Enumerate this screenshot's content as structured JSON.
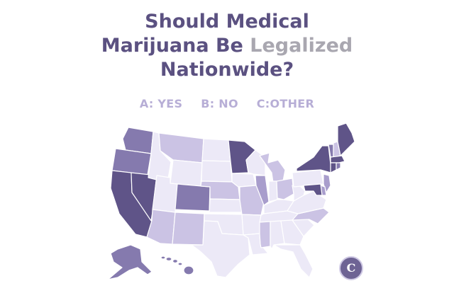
{
  "title": {
    "line1": "Should Medical",
    "line2a": "Marijuana Be ",
    "line2b": "Legalized",
    "line3": "Nationwide?"
  },
  "legend": {
    "a": "A: YES",
    "b": "B: NO",
    "c": "C:OTHER"
  },
  "logo": {
    "glyph": "C"
  },
  "colors": {
    "title": "#5b5181",
    "title_muted": "#a9a7b0",
    "legend": "#b7aed6",
    "level_1": "#ece9f7",
    "level_2": "#cbc3e4",
    "level_3": "#a89dcc",
    "level_4": "#857aae",
    "level_5": "#5f5488"
  },
  "map_data": {
    "shading_levels": 5,
    "states": [
      {
        "name": "WA",
        "level": 4
      },
      {
        "name": "OR",
        "level": 4
      },
      {
        "name": "CA",
        "level": 5
      },
      {
        "name": "NV",
        "level": 5
      },
      {
        "name": "ID",
        "level": 1
      },
      {
        "name": "MT",
        "level": 2
      },
      {
        "name": "WY",
        "level": 1
      },
      {
        "name": "UT",
        "level": 1
      },
      {
        "name": "AZ",
        "level": 2
      },
      {
        "name": "CO",
        "level": 4
      },
      {
        "name": "NM",
        "level": 2
      },
      {
        "name": "ND",
        "level": 1
      },
      {
        "name": "SD",
        "level": 1
      },
      {
        "name": "NE",
        "level": 2
      },
      {
        "name": "KS",
        "level": 1
      },
      {
        "name": "OK",
        "level": 1
      },
      {
        "name": "TX",
        "level": 1
      },
      {
        "name": "MN",
        "level": 5
      },
      {
        "name": "IA",
        "level": 1
      },
      {
        "name": "MO",
        "level": 2
      },
      {
        "name": "AR",
        "level": 1
      },
      {
        "name": "LA",
        "level": 1
      },
      {
        "name": "WI",
        "level": 1
      },
      {
        "name": "IL",
        "level": 3
      },
      {
        "name": "MI",
        "level": 2
      },
      {
        "name": "IN",
        "level": 1
      },
      {
        "name": "OH",
        "level": 2
      },
      {
        "name": "KY",
        "level": 1
      },
      {
        "name": "TN",
        "level": 1
      },
      {
        "name": "MS",
        "level": 2
      },
      {
        "name": "AL",
        "level": 1
      },
      {
        "name": "GA",
        "level": 1
      },
      {
        "name": "FL",
        "level": 1
      },
      {
        "name": "SC",
        "level": 1
      },
      {
        "name": "NC",
        "level": 2
      },
      {
        "name": "VA",
        "level": 1
      },
      {
        "name": "WV",
        "level": 1
      },
      {
        "name": "PA",
        "level": 1
      },
      {
        "name": "NY",
        "level": 5
      },
      {
        "name": "VT",
        "level": 4
      },
      {
        "name": "NH",
        "level": 2
      },
      {
        "name": "ME",
        "level": 5
      },
      {
        "name": "MA",
        "level": 5
      },
      {
        "name": "CT",
        "level": 5
      },
      {
        "name": "RI",
        "level": 4
      },
      {
        "name": "NJ",
        "level": 3
      },
      {
        "name": "DE",
        "level": 3
      },
      {
        "name": "MD",
        "level": 5
      },
      {
        "name": "AK",
        "level": 4
      },
      {
        "name": "HI",
        "level": 4
      }
    ]
  }
}
